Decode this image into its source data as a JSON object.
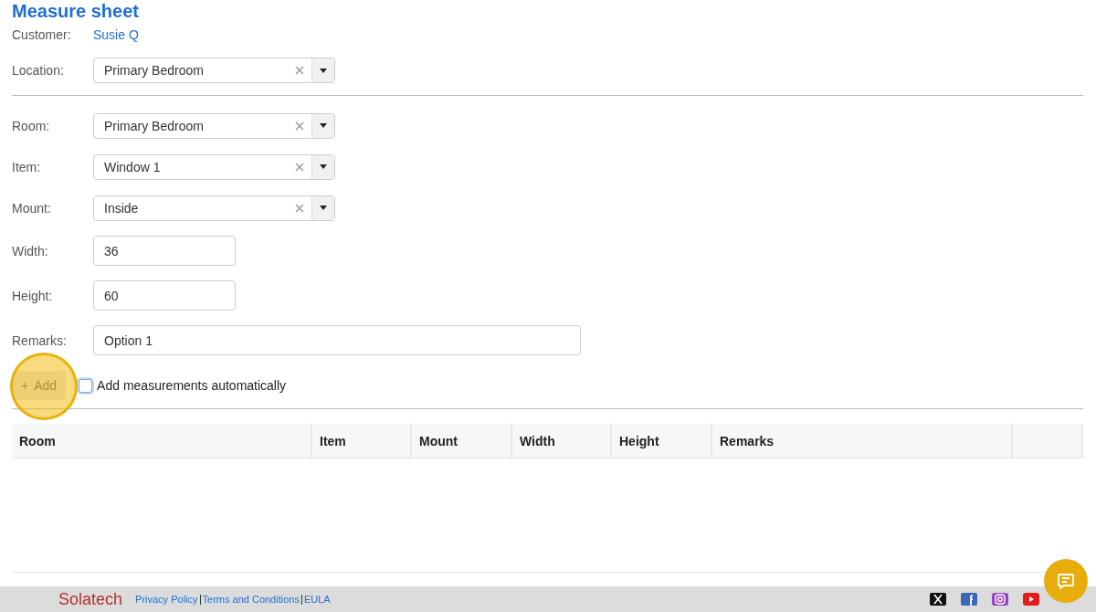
{
  "title": "Measure sheet",
  "customer": {
    "label": "Customer:",
    "value": "Susie Q"
  },
  "location": {
    "label": "Location:",
    "value": "Primary Bedroom"
  },
  "fields": [
    {
      "kind": "select",
      "label": "Room:",
      "value": "Primary Bedroom"
    },
    {
      "kind": "select",
      "label": "Item:",
      "value": "Window 1"
    },
    {
      "kind": "select",
      "label": "Mount:",
      "value": "Inside"
    },
    {
      "kind": "short",
      "label": "Width:",
      "value": "36"
    },
    {
      "kind": "short",
      "label": "Height:",
      "value": "60"
    },
    {
      "kind": "wide",
      "label": "Remarks:",
      "value": "Option 1"
    }
  ],
  "add_button": {
    "icon": "+",
    "label": "Add",
    "highlighted": true
  },
  "auto_checkbox": {
    "label": "Add measurements automatically",
    "checked": false
  },
  "table": {
    "columns": [
      "Room",
      "Item",
      "Mount",
      "Width",
      "Height",
      "Remarks"
    ]
  },
  "footer": {
    "logo": "Solatech",
    "links": [
      "Privacy Policy",
      "Terms and Conditions",
      "EULA"
    ]
  }
}
